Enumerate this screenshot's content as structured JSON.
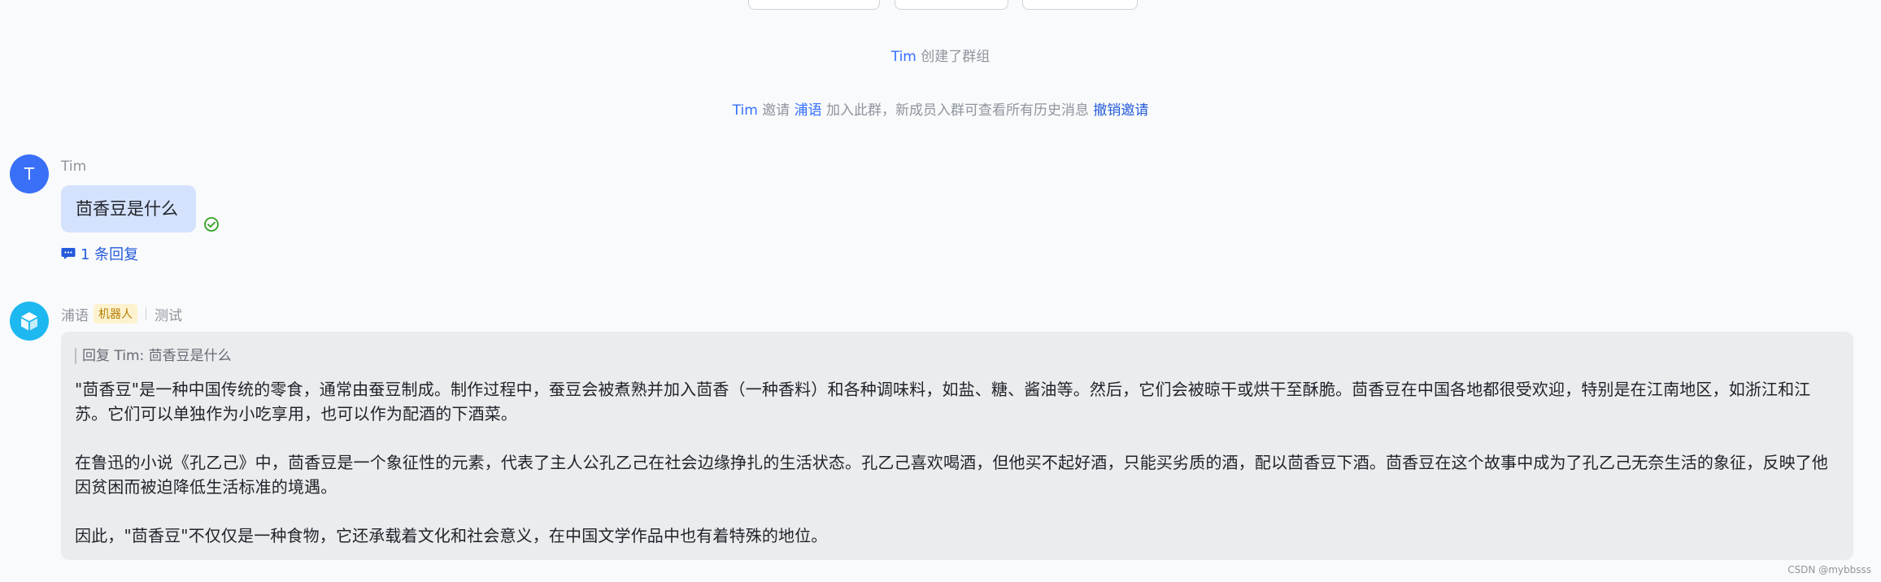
{
  "system_messages": {
    "created": {
      "user": "Tim",
      "text": "创建了群组"
    },
    "invited": {
      "inviter": "Tim",
      "verb": "邀请",
      "invitee": "浦语",
      "text": "加入此群，新成员入群可查看所有历史消息",
      "action": "撤销邀请"
    }
  },
  "messages": [
    {
      "sender": "Tim",
      "avatar_initial": "T",
      "text": "茴香豆是什么",
      "status_icon": "check-circle-icon",
      "reply_count_text": "1 条回复"
    },
    {
      "sender": "浦语",
      "badge": "机器人",
      "tag": "测试",
      "quote": "回复 Tim:  茴香豆是什么",
      "paragraphs": [
        "\"茴香豆\"是一种中国传统的零食，通常由蚕豆制成。制作过程中，蚕豆会被煮熟并加入茴香（一种香料）和各种调味料，如盐、糖、酱油等。然后，它们会被晾干或烘干至酥脆。茴香豆在中国各地都很受欢迎，特别是在江南地区，如浙江和江苏。它们可以单独作为小吃享用，也可以作为配酒的下酒菜。",
        "在鲁迅的小说《孔乙己》中，茴香豆是一个象征性的元素，代表了主人公孔乙己在社会边缘挣扎的生活状态。孔乙己喜欢喝酒，但他买不起好酒，只能买劣质的酒，配以茴香豆下酒。茴香豆在这个故事中成为了孔乙己无奈生活的象征，反映了他因贫困而被迫降低生活标准的境遇。",
        "因此，\"茴香豆\"不仅仅是一种食物，它还承载着文化和社会意义，在中国文学作品中也有着特殊的地位。"
      ]
    }
  ],
  "watermark": "CSDN @mybbsss",
  "colors": {
    "link": "#245bdb",
    "user_bubble": "#d4e2fd",
    "bot_bubble": "#ebecee",
    "badge_bg": "#fdf2cf"
  }
}
